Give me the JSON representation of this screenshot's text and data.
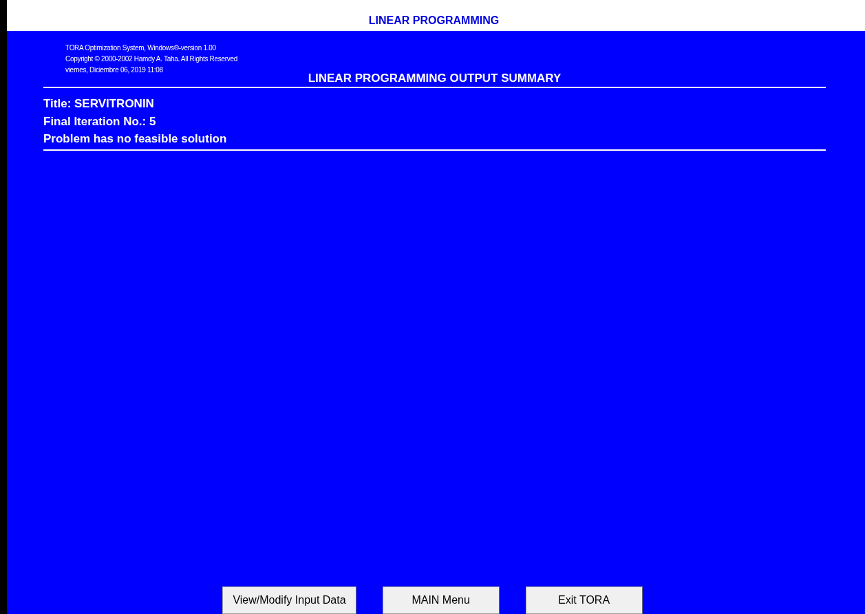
{
  "window": {
    "title": "LINEAR PROGRAMMING"
  },
  "header": {
    "lines": [
      "TORA Optimization System, Windows®-version 1.00",
      "Copyright © 2000-2002 Hamdy A. Taha.  All Rights Reserved",
      "viernes, Diciembre 06, 2019 11:08"
    ]
  },
  "summary": {
    "heading": "LINEAR PROGRAMMING OUTPUT SUMMARY",
    "lines": [
      "Title: SERVITRONIN",
      "Final Iteration No.:  5",
      "Problem has no feasible solution"
    ]
  },
  "buttons": [
    "View/Modify Input Data",
    "MAIN Menu",
    "Exit TORA"
  ]
}
